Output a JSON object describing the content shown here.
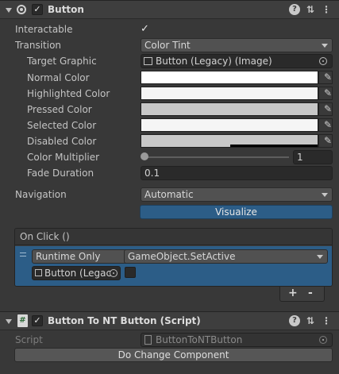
{
  "button_component": {
    "title": "Button",
    "enabled": true,
    "header_icons": [
      "help-icon",
      "presets-icon",
      "kebab-menu-icon"
    ],
    "rows": {
      "interactable": {
        "label": "Interactable",
        "checked": true
      },
      "transition": {
        "label": "Transition",
        "value": "Color Tint"
      },
      "target_graphic": {
        "label": "Target Graphic",
        "value": "Button (Legacy) (Image)"
      },
      "normal_color": {
        "label": "Normal Color",
        "color": "#ffffff"
      },
      "highlighted_color": {
        "label": "Highlighted Color",
        "color": "#f5f5f5"
      },
      "pressed_color": {
        "label": "Pressed Color",
        "color": "#c8c8c8"
      },
      "selected_color": {
        "label": "Selected Color",
        "color": "#f5f5f5"
      },
      "disabled_color": {
        "label": "Disabled Color",
        "color": "#c8c8c8",
        "alpha_fraction": 0.5
      },
      "color_multiplier": {
        "label": "Color Multiplier",
        "value": "1",
        "slider_fraction": 0.0
      },
      "fade_duration": {
        "label": "Fade Duration",
        "value": "0.1"
      },
      "navigation": {
        "label": "Navigation",
        "value": "Automatic"
      }
    },
    "visualize_label": "Visualize",
    "on_click": {
      "header": "On Click ()",
      "runtime_mode": "Runtime Only",
      "function": "GameObject.SetActive",
      "target_object": "Button (Legac",
      "bool_arg": false,
      "add_label": "+",
      "remove_label": "-"
    }
  },
  "script_component": {
    "title": "Button To NT Button (Script)",
    "enabled": true,
    "script_label": "Script",
    "script_value": "ButtonToNTButton",
    "action_button": "Do Change Component"
  },
  "colors": {
    "panel_bg": "#383838",
    "header_bg": "#3e3e3e",
    "selection_blue": "#2c5d87",
    "field_bg": "#2a2a2a"
  }
}
